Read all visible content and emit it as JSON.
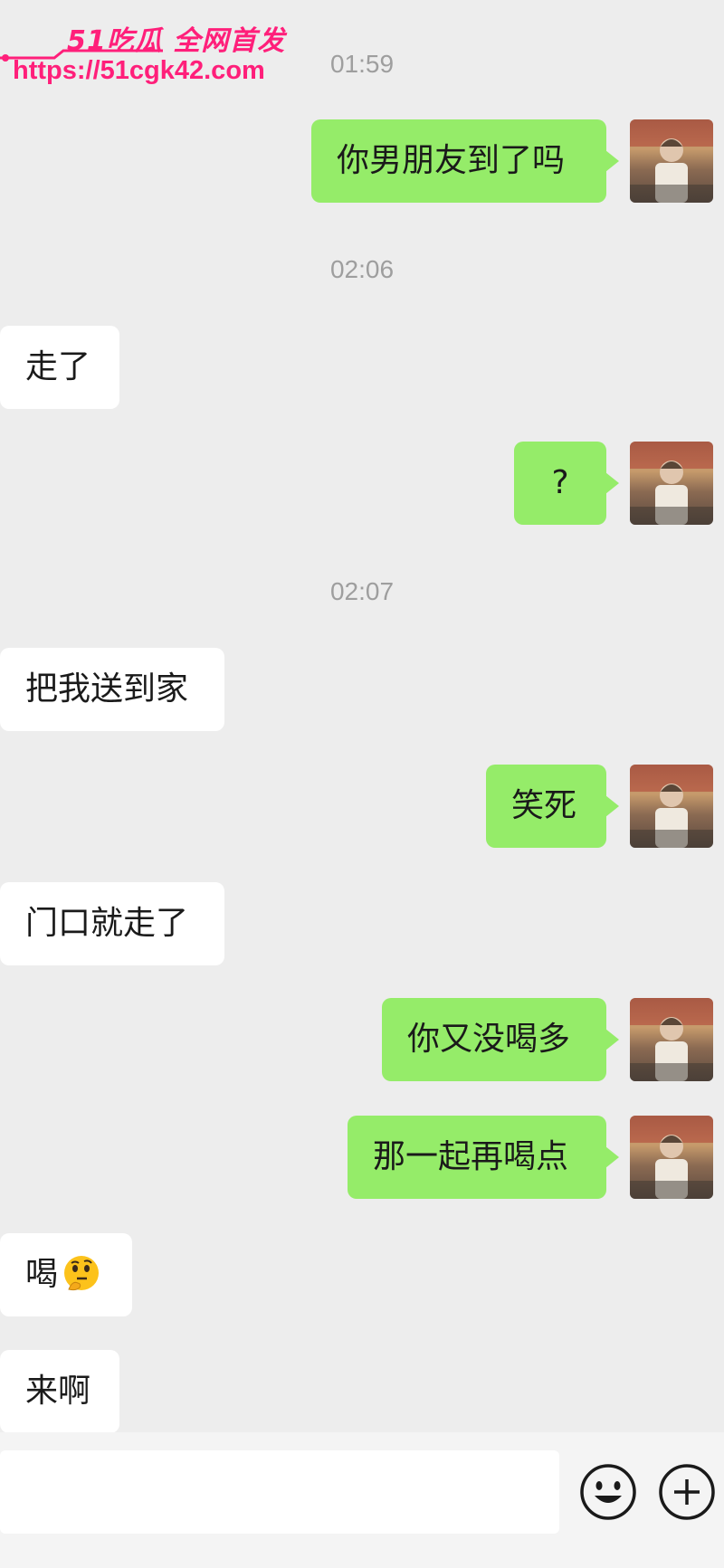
{
  "watermark": {
    "brand": "51吃瓜 全网首发",
    "url": "https://51cgk42.com"
  },
  "messages": [
    {
      "type": "time",
      "text": "01:59"
    },
    {
      "type": "mine",
      "text": "你男朋友到了吗"
    },
    {
      "type": "time",
      "text": "02:06"
    },
    {
      "type": "theirs",
      "text": "走了"
    },
    {
      "type": "mine",
      "text": "?"
    },
    {
      "type": "time",
      "text": "02:07"
    },
    {
      "type": "theirs",
      "text": "把我送到家"
    },
    {
      "type": "mine",
      "text": "笑死"
    },
    {
      "type": "theirs",
      "text": "门口就走了"
    },
    {
      "type": "mine",
      "text": "你又没喝多"
    },
    {
      "type": "mine",
      "text": "那一起再喝点"
    },
    {
      "type": "theirs",
      "text": "喝",
      "emoji": "thinking-face"
    },
    {
      "type": "theirs",
      "text": "来啊"
    }
  ],
  "input_bar": {
    "value": "",
    "icons": [
      "smiley-icon",
      "plus-icon"
    ]
  },
  "colors": {
    "background": "#ededed",
    "sent_bubble": "#95ec69",
    "received_bubble": "#ffffff",
    "timestamp": "#9e9e9e",
    "watermark": "#ff1f7a"
  }
}
